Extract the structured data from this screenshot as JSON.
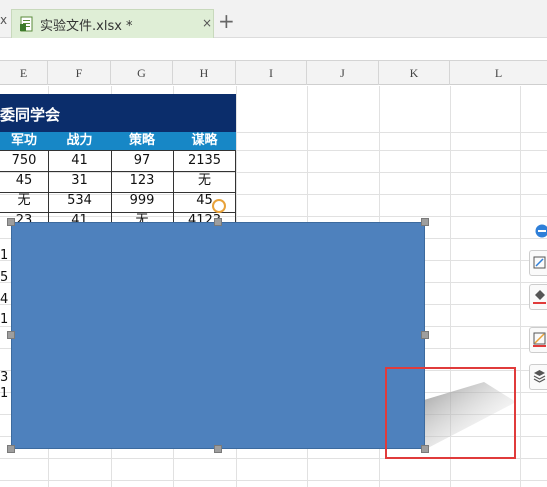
{
  "tab": {
    "left_close": "x",
    "title": "实验文件.xlsx *",
    "close": "×",
    "add": "+"
  },
  "columns": [
    "E",
    "F",
    "G",
    "H",
    "I",
    "J",
    "K",
    "L"
  ],
  "table": {
    "title": "委同学会",
    "headers": [
      "军功",
      "战力",
      "策略",
      "谋略"
    ],
    "rows": [
      [
        "750",
        "41",
        "97",
        "2135"
      ],
      [
        "45",
        "31",
        "123",
        "无"
      ],
      [
        "无",
        "534",
        "999",
        "45"
      ],
      [
        "23",
        "41",
        "无",
        "4123"
      ]
    ]
  },
  "left_fragments": [
    "1",
    "5",
    "4",
    "1",
    "3",
    "1"
  ],
  "colors": {
    "title_band": "#0b2d6b",
    "header_band": "#1787c6",
    "shape_fill": "#4e81bd",
    "annotation": "#e03b3b",
    "tab_active": "#dfeed6"
  },
  "tools": [
    "shape-style-icon",
    "fill-icon",
    "outline-icon",
    "layer-icon"
  ]
}
